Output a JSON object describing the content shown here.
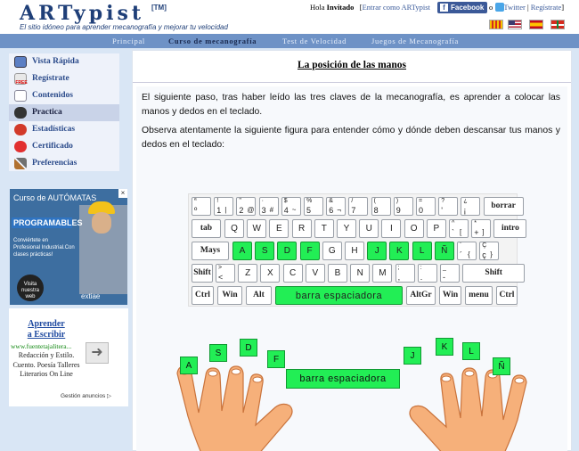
{
  "header": {
    "logo": "ARTypist",
    "tm": "[TM]",
    "tagline": "El sitio idóneo para aprender mecanografía y mejorar tu velocidad",
    "hola": "Hola",
    "user": "Invitado",
    "bracket_open": "[",
    "login_text": "Entrar como ARTypist",
    "facebook": "Facebook",
    "or": "o",
    "twitter": "Twitter",
    "separator": "|",
    "register": "Regístrate",
    "bracket_close": "]"
  },
  "nav": {
    "items": [
      "Principal",
      "Curso de mecanografía",
      "Test de Velocidad",
      "Juegos de Mecanografía"
    ],
    "active": "Curso de mecanografía"
  },
  "sidebar": {
    "items": [
      {
        "label": "Vista Rápida",
        "icon": "monitor-icon"
      },
      {
        "label": "Regístrate",
        "icon": "free-icon"
      },
      {
        "label": "Contenidos",
        "icon": "document-icon"
      },
      {
        "label": "Practica",
        "icon": "typing-icon"
      },
      {
        "label": "Estadísticas",
        "icon": "chart-icon"
      },
      {
        "label": "Certificado",
        "icon": "certificate-icon"
      },
      {
        "label": "Preferencias",
        "icon": "tools-icon"
      }
    ],
    "active": "Practica"
  },
  "ad_banner": {
    "line1": "Curso de AUTÓMATAS",
    "line2": "PROGRAMABLES",
    "sub": "Conviértete en Profesional Industrial.Con clases prácticas!",
    "visita": "Visita nuestra web",
    "brand": "extiae",
    "close": "×"
  },
  "text_ad": {
    "title": "Aprender a Escribir",
    "url": "www.fuentetajalitera...",
    "text": "Redacción y Estilo. Cuento. Poesía Talleres Literarios On Line",
    "footer": "Gestión anuncios"
  },
  "main": {
    "title": "La posición de las manos",
    "para1": "El siguiente paso, tras haber leído las tres claves de la mecanografía, es aprender a colocar las manos y dedos en el teclado.",
    "para2": "Observa atentamente la siguiente figura para entender cómo y dónde deben descansar tus manos y dedos en el teclado:"
  },
  "keyboard": {
    "row1": [
      {
        "u": "ª",
        "l": "º"
      },
      {
        "u": "!",
        "l": "1",
        "r": "|"
      },
      {
        "u": "\"",
        "l": "2",
        "r": "@"
      },
      {
        "u": "·",
        "l": "3",
        "r": "#"
      },
      {
        "u": "$",
        "l": "4",
        "r": "~"
      },
      {
        "u": "%",
        "l": "5"
      },
      {
        "u": "&",
        "l": "6",
        "r": "¬"
      },
      {
        "u": "/",
        "l": "7"
      },
      {
        "u": "(",
        "l": "8"
      },
      {
        "u": ")",
        "l": "9"
      },
      {
        "u": "=",
        "l": "0"
      },
      {
        "u": "?",
        "l": "'"
      },
      {
        "u": "¿",
        "l": "¡"
      }
    ],
    "row2": [
      "Q",
      "W",
      "E",
      "R",
      "T",
      "Y",
      "U",
      "I",
      "O",
      "P"
    ],
    "row2_extra": [
      {
        "u": "^",
        "l": "`",
        "r": "["
      },
      {
        "u": "*",
        "l": "+",
        "r": "]"
      }
    ],
    "row3": [
      "A",
      "S",
      "D",
      "F",
      "G",
      "H",
      "J",
      "K",
      "L",
      "Ñ"
    ],
    "row3_extra": [
      {
        "u": "¨",
        "l": "´",
        "r": "{"
      },
      {
        "u": "Ç",
        "l": "ç",
        "r": "}"
      }
    ],
    "row4_first": {
      "u": ">",
      "l": "<"
    },
    "row4": [
      "Z",
      "X",
      "C",
      "V",
      "B",
      "N",
      "M"
    ],
    "row4_extra": [
      {
        "u": ";",
        "l": ","
      },
      {
        "u": ":",
        "l": "."
      },
      {
        "u": "_",
        "l": "-"
      }
    ],
    "mods": {
      "borrar": "borrar",
      "tab": "tab",
      "intro": "intro",
      "mays": "Mays",
      "shift": "Shift",
      "ctrl": "Ctrl",
      "win": "Win",
      "alt": "Alt",
      "space": "barra espaciadora",
      "altgr": "AltGr",
      "menu": "menu"
    },
    "home_keys": [
      "A",
      "S",
      "D",
      "F",
      "J",
      "K",
      "L",
      "Ñ"
    ]
  },
  "hands": {
    "left_fingers": [
      "A",
      "S",
      "D",
      "F"
    ],
    "right_fingers": [
      "J",
      "K",
      "L",
      "Ñ"
    ],
    "thumb_label": "barra espaciadora"
  },
  "colors": {
    "home_key": "#22ee55",
    "nav_bg": "#6e92c6",
    "skin": "#f6b07a"
  }
}
